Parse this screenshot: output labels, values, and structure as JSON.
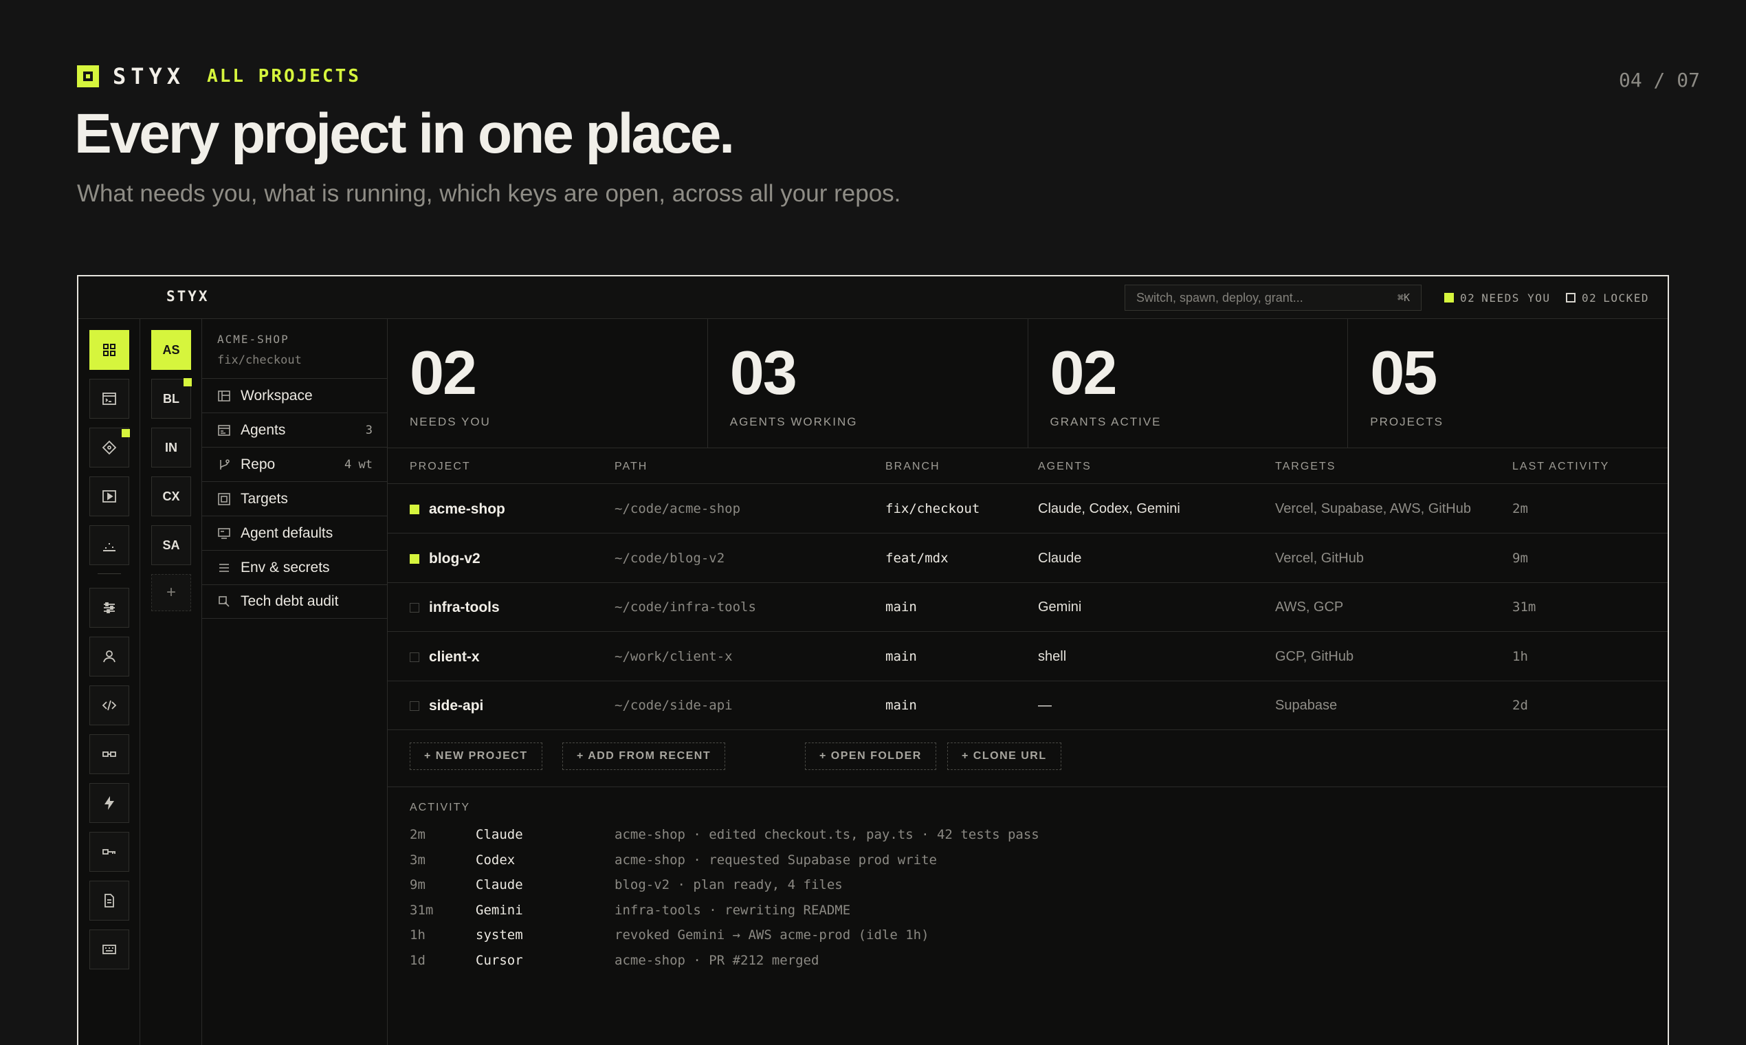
{
  "header": {
    "brand": "STYX",
    "section": "ALL PROJECTS",
    "page_indicator": "04 / 07",
    "title": "Every project in one place.",
    "subtitle": "What needs you, what is running, which keys are open, across all your repos."
  },
  "app": {
    "brand": "STYX",
    "search": {
      "placeholder": "Switch, spawn, deploy, grant...",
      "shortcut": "⌘K"
    },
    "status": {
      "needs_you": {
        "count": "02",
        "label": "NEEDS YOU"
      },
      "locked": {
        "count": "02",
        "label": "LOCKED"
      }
    },
    "rail_icons": [
      "grid-icon",
      "terminal-window-icon",
      "diamond-icon",
      "play-icon",
      "chart-icon",
      "sliders-icon",
      "user-icon",
      "code-icon",
      "link-icon",
      "bolt-icon",
      "key-icon",
      "document-icon",
      "keyboard-icon"
    ],
    "project_switcher": [
      "AS",
      "BL",
      "IN",
      "CX",
      "SA"
    ],
    "add_label": "+",
    "nav": {
      "project": "ACME-SHOP",
      "branch": "fix/checkout",
      "items": [
        {
          "label": "Workspace",
          "count": ""
        },
        {
          "label": "Agents",
          "count": "3"
        },
        {
          "label": "Repo",
          "count": "4 wt"
        },
        {
          "label": "Targets",
          "count": ""
        },
        {
          "label": "Agent defaults",
          "count": ""
        },
        {
          "label": "Env & secrets",
          "count": ""
        },
        {
          "label": "Tech debt audit",
          "count": ""
        }
      ]
    },
    "stats": [
      {
        "value": "02",
        "label": "NEEDS YOU"
      },
      {
        "value": "03",
        "label": "AGENTS WORKING"
      },
      {
        "value": "02",
        "label": "GRANTS ACTIVE"
      },
      {
        "value": "05",
        "label": "PROJECTS"
      }
    ],
    "table": {
      "columns": [
        "PROJECT",
        "PATH",
        "BRANCH",
        "AGENTS",
        "TARGETS",
        "LAST ACTIVITY"
      ],
      "rows": [
        {
          "name": "acme-shop",
          "path": "~/code/acme-shop",
          "branch": "fix/checkout",
          "agents": "Claude, Codex, Gemini",
          "targets": "Vercel, Supabase, AWS, GitHub",
          "last": "2m",
          "attention": true
        },
        {
          "name": "blog-v2",
          "path": "~/code/blog-v2",
          "branch": "feat/mdx",
          "agents": "Claude",
          "targets": "Vercel, GitHub",
          "last": "9m",
          "attention": true
        },
        {
          "name": "infra-tools",
          "path": "~/code/infra-tools",
          "branch": "main",
          "agents": "Gemini",
          "targets": "AWS, GCP",
          "last": "31m",
          "attention": false
        },
        {
          "name": "client-x",
          "path": "~/work/client-x",
          "branch": "main",
          "agents": "shell",
          "targets": "GCP, GitHub",
          "last": "1h",
          "attention": false
        },
        {
          "name": "side-api",
          "path": "~/code/side-api",
          "branch": "main",
          "agents": "—",
          "targets": "Supabase",
          "last": "2d",
          "attention": false
        }
      ]
    },
    "actions": [
      "+ NEW PROJECT",
      "+ ADD FROM RECENT",
      "+ OPEN FOLDER",
      "+ CLONE URL"
    ],
    "activity": {
      "title": "ACTIVITY",
      "entries": [
        {
          "time": "2m",
          "who": "Claude",
          "message": "acme-shop · edited checkout.ts, pay.ts · 42 tests pass"
        },
        {
          "time": "3m",
          "who": "Codex",
          "message": "acme-shop · requested Supabase prod write"
        },
        {
          "time": "9m",
          "who": "Claude",
          "message": "blog-v2 · plan ready, 4 files"
        },
        {
          "time": "31m",
          "who": "Gemini",
          "message": "infra-tools · rewriting README"
        },
        {
          "time": "1h",
          "who": "system",
          "message": "revoked Gemini → AWS acme-prod (idle 1h)"
        },
        {
          "time": "1d",
          "who": "Cursor",
          "message": "acme-shop · PR #212 merged"
        }
      ]
    }
  },
  "colors": {
    "accent": "#d6f53d",
    "background": "#141414",
    "panel": "#0e0e0d"
  }
}
